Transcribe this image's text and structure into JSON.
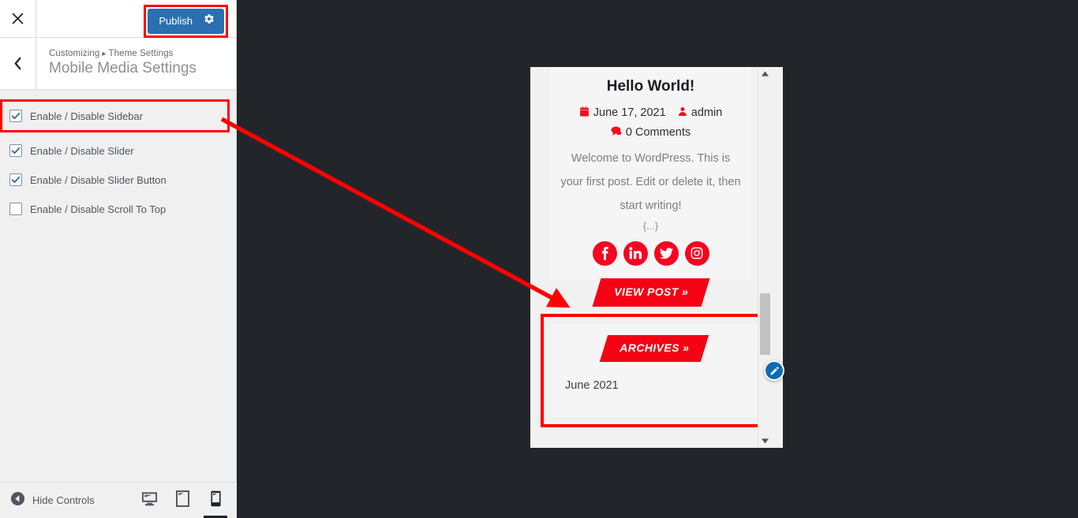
{
  "app": {
    "accent_blue": "#2b6fb0",
    "annotation_red": "#ff0000",
    "theme_red": "#f50214"
  },
  "header": {
    "close_icon": "close-icon",
    "publish_label": "Publish",
    "publish_gear_icon": "gear-icon"
  },
  "panel": {
    "back_icon": "chevron-left-icon",
    "breadcrumb_root": "Customizing",
    "breadcrumb_separator": "▸",
    "breadcrumb_parent": "Theme Settings",
    "title": "Mobile Media Settings"
  },
  "controls": [
    {
      "label": "Enable / Disable Sidebar",
      "checked": true,
      "highlighted": true
    },
    {
      "label": "Enable / Disable Slider",
      "checked": true,
      "highlighted": false
    },
    {
      "label": "Enable / Disable Slider Button",
      "checked": true,
      "highlighted": false
    },
    {
      "label": "Enable / Disable Scroll To Top",
      "checked": false,
      "highlighted": false
    }
  ],
  "footer": {
    "hide_controls_label": "Hide Controls",
    "hide_controls_icon": "collapse-left-icon",
    "devices": [
      {
        "name": "desktop",
        "icon": "desktop-icon",
        "active": false
      },
      {
        "name": "tablet",
        "icon": "tablet-icon",
        "active": false
      },
      {
        "name": "mobile",
        "icon": "mobile-icon",
        "active": true
      }
    ]
  },
  "preview": {
    "post": {
      "title": "Hello World!",
      "date_icon": "calendar-icon",
      "date": "June 17, 2021",
      "author_icon": "user-icon",
      "author": "admin",
      "comments_icon": "comment-icon",
      "comments": "0 Comments",
      "excerpt": "Welcome to WordPress. This is your first post. Edit or delete it, then start writing!",
      "ellipsis": "{...}",
      "social": [
        {
          "name": "facebook",
          "icon": "facebook-icon"
        },
        {
          "name": "linkedin",
          "icon": "linkedin-icon"
        },
        {
          "name": "twitter",
          "icon": "twitter-icon"
        },
        {
          "name": "instagram",
          "icon": "instagram-icon"
        }
      ],
      "view_post_label": "VIEW POST »"
    },
    "archives_widget": {
      "title": "ARCHIVES »",
      "items": [
        "June 2021"
      ]
    },
    "edit_shortcut_icon": "pencil-icon",
    "scrollbar": {
      "up_icon": "caret-up-icon",
      "down_icon": "caret-down-icon"
    }
  }
}
